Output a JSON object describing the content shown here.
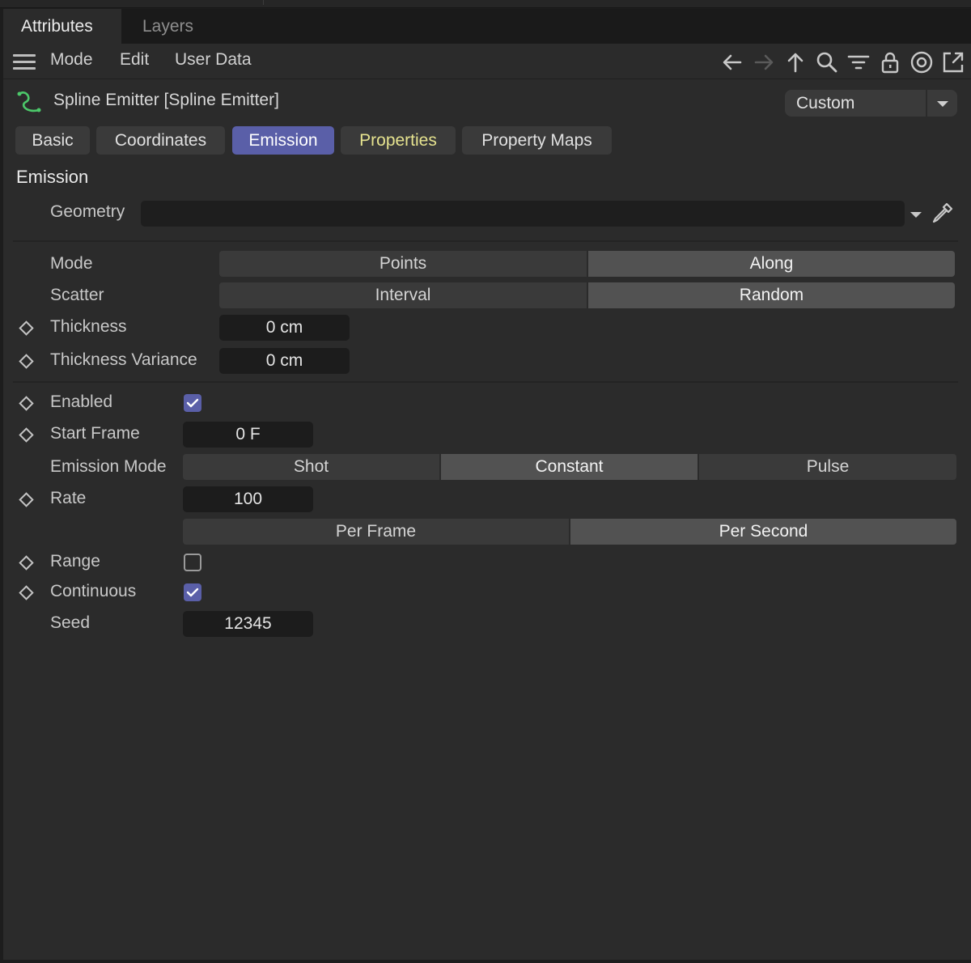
{
  "window_tabs": [
    {
      "label": "Attributes",
      "active": true
    },
    {
      "label": "Layers",
      "active": false
    }
  ],
  "menu": {
    "items": [
      "Mode",
      "Edit",
      "User Data"
    ],
    "toolbar_icons": [
      "arrow-left-icon",
      "arrow-right-icon",
      "arrow-up-icon",
      "search-icon",
      "filter-icon",
      "lock-icon",
      "target-icon",
      "new-window-icon"
    ]
  },
  "object": {
    "title": "Spline Emitter [Spline Emitter]",
    "icon": "spline-emitter-icon",
    "preset": "Custom"
  },
  "page_tabs": [
    {
      "label": "Basic",
      "active": false
    },
    {
      "label": "Coordinates",
      "active": false
    },
    {
      "label": "Emission",
      "active": true
    },
    {
      "label": "Properties",
      "active": false,
      "color": "#e6e38f"
    },
    {
      "label": "Property Maps",
      "active": false
    }
  ],
  "section": {
    "title": "Emission",
    "geometry_label": "Geometry",
    "geometry_value": "",
    "mode": {
      "label": "Mode",
      "options": [
        "Points",
        "Along"
      ],
      "selected": "Along"
    },
    "scatter": {
      "label": "Scatter",
      "options": [
        "Interval",
        "Random"
      ],
      "selected": "Random"
    },
    "thickness": {
      "label": "Thickness",
      "value": "0 cm"
    },
    "thickness_variance": {
      "label": "Thickness Variance",
      "value": "0 cm"
    },
    "enabled": {
      "label": "Enabled",
      "checked": true
    },
    "start_frame": {
      "label": "Start Frame",
      "value": "0 F"
    },
    "emission_mode": {
      "label": "Emission Mode",
      "options": [
        "Shot",
        "Constant",
        "Pulse"
      ],
      "selected": "Constant"
    },
    "rate": {
      "label": "Rate",
      "value": "100",
      "unit_options": [
        "Per Frame",
        "Per Second"
      ],
      "unit_selected": "Per Second"
    },
    "range": {
      "label": "Range",
      "checked": false
    },
    "continuous": {
      "label": "Continuous",
      "checked": true
    },
    "seed": {
      "label": "Seed",
      "value": "12345"
    }
  },
  "colors": {
    "accent": "#5a5fa8",
    "panel_bg": "#2b2b2b",
    "properties_tab_text": "#e6e38f",
    "spline_icon": "#4cc86a"
  }
}
